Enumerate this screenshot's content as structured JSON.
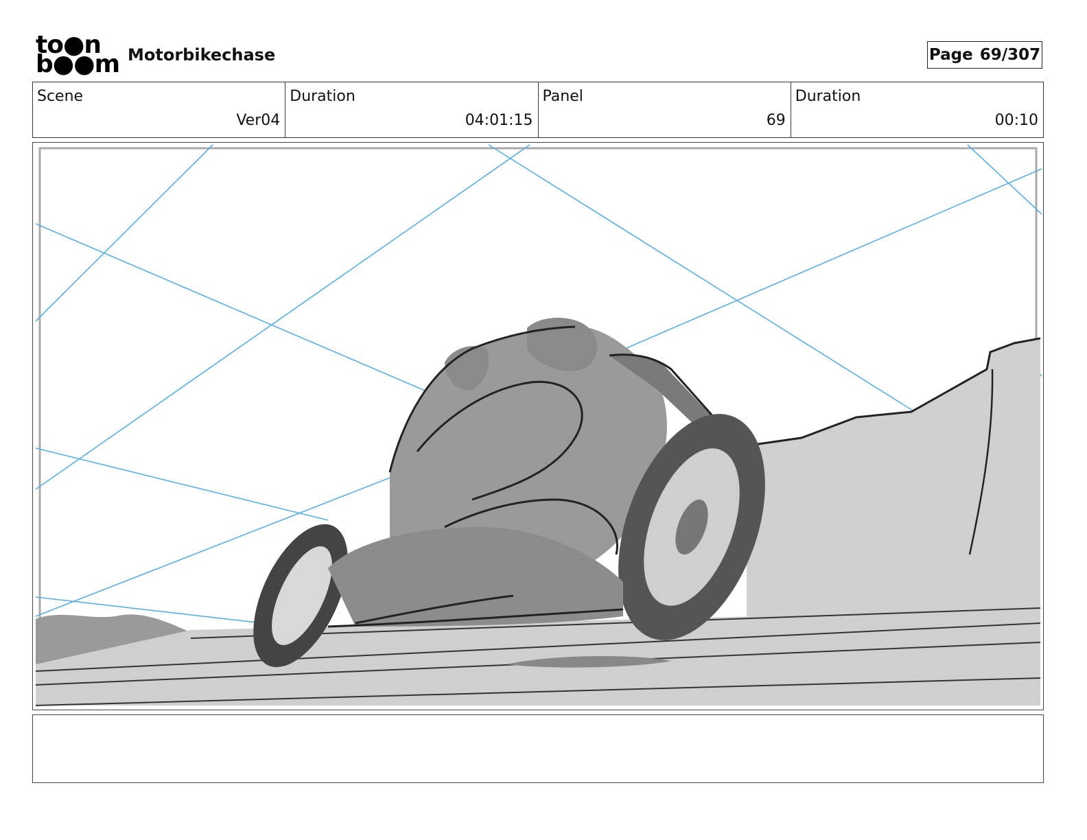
{
  "header": {
    "logo_line1": "to●n",
    "logo_line2": "b●●m",
    "project_title": "Motorbikechase",
    "page_label": "Page",
    "page_value": "69/307"
  },
  "info": {
    "scene_label": "Scene",
    "scene_value": "Ver04",
    "scene_duration_label": "Duration",
    "scene_duration_value": "04:01:15",
    "panel_label": "Panel",
    "panel_value": "69",
    "panel_duration_label": "Duration",
    "panel_duration_value": "00:10"
  },
  "panel": {
    "image": "sketch of a motorbike rider leaning into a turn on a road",
    "guide_color": "#5aaee0",
    "shade_light": "#cfcfcf",
    "shade_mid": "#9a9a9a",
    "shade_dark": "#555555"
  },
  "notes": {
    "text": ""
  }
}
